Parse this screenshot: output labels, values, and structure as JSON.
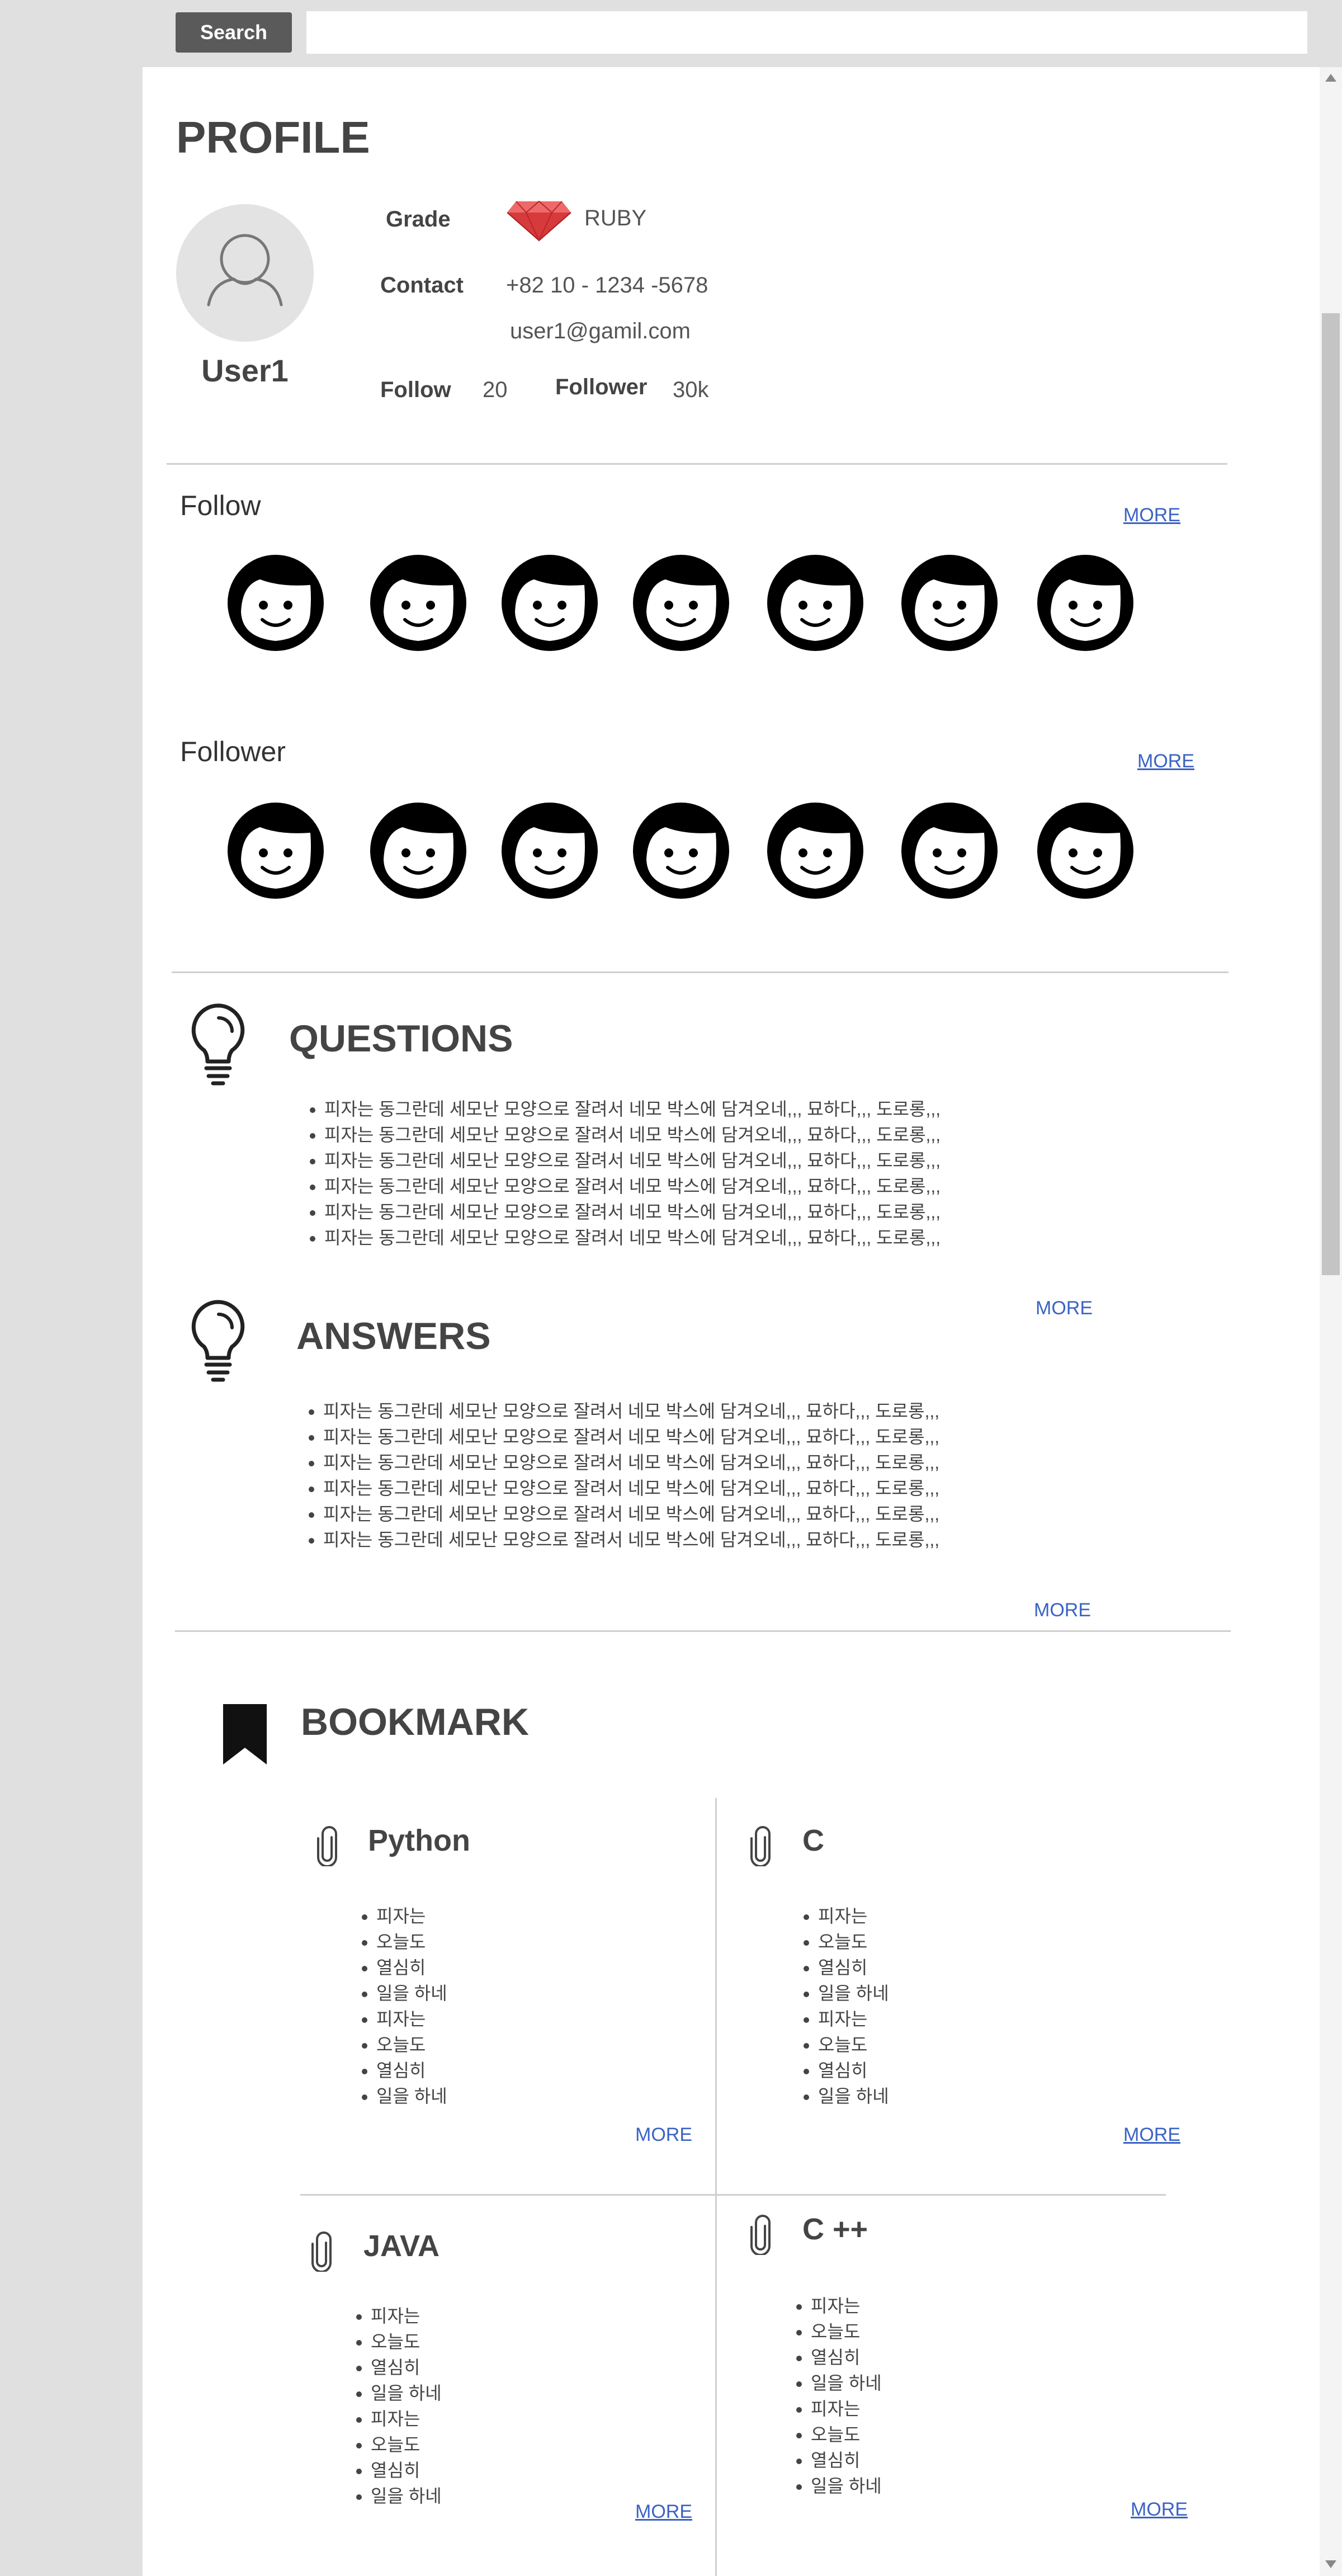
{
  "search": {
    "button_label": "Search",
    "placeholder": ""
  },
  "profile": {
    "heading": "PROFILE",
    "username": "User1",
    "grade_label": "Grade",
    "grade_value": "RUBY",
    "contact_label": "Contact",
    "phone": "+82 10 - 1234 -5678",
    "email": "user1@gamil.com",
    "follow_label": "Follow",
    "follow_count": "20",
    "follower_label": "Follower",
    "follower_count": "30k"
  },
  "follow_section": {
    "title": "Follow",
    "more": "MORE",
    "face_count": 7
  },
  "follower_section": {
    "title": "Follower",
    "more": "MORE",
    "face_count": 7
  },
  "questions": {
    "title": "QUESTIONS",
    "more": "MORE",
    "items": [
      "피자는 동그란데 세모난 모양으로 잘려서 네모 박스에 담겨오네,,, 묘하다,,, 도로롱,,,",
      "피자는 동그란데 세모난 모양으로 잘려서 네모 박스에 담겨오네,,, 묘하다,,, 도로롱,,,",
      "피자는 동그란데 세모난 모양으로 잘려서 네모 박스에 담겨오네,,, 묘하다,,, 도로롱,,,",
      "피자는 동그란데 세모난 모양으로 잘려서 네모 박스에 담겨오네,,, 묘하다,,, 도로롱,,,",
      "피자는 동그란데 세모난 모양으로 잘려서 네모 박스에 담겨오네,,, 묘하다,,, 도로롱,,,",
      "피자는 동그란데 세모난 모양으로 잘려서 네모 박스에 담겨오네,,, 묘하다,,, 도로롱,,,"
    ]
  },
  "answers": {
    "title": "ANSWERS",
    "more": "MORE",
    "items": [
      "피자는 동그란데 세모난 모양으로 잘려서 네모 박스에 담겨오네,,, 묘하다,,, 도로롱,,,",
      "피자는 동그란데 세모난 모양으로 잘려서 네모 박스에 담겨오네,,, 묘하다,,, 도로롱,,,",
      "피자는 동그란데 세모난 모양으로 잘려서 네모 박스에 담겨오네,,, 묘하다,,, 도로롱,,,",
      "피자는 동그란데 세모난 모양으로 잘려서 네모 박스에 담겨오네,,, 묘하다,,, 도로롱,,,",
      "피자는 동그란데 세모난 모양으로 잘려서 네모 박스에 담겨오네,,, 묘하다,,, 도로롱,,,",
      "피자는 동그란데 세모난 모양으로 잘려서 네모 박스에 담겨오네,,, 묘하다,,, 도로롱,,,"
    ]
  },
  "bookmark": {
    "title": "BOOKMARK",
    "categories": [
      {
        "name": "Python",
        "more": "MORE",
        "items": [
          "피자는",
          "오늘도",
          "열심히",
          "일을 하네",
          "피자는",
          "오늘도",
          "열심히",
          "일을 하네"
        ]
      },
      {
        "name": "C",
        "more": "MORE",
        "items": [
          "피자는",
          "오늘도",
          "열심히",
          "일을 하네",
          "피자는",
          "오늘도",
          "열심히",
          "일을 하네"
        ]
      },
      {
        "name": "JAVA",
        "more": "MORE",
        "items": [
          "피자는",
          "오늘도",
          "열심히",
          "일을 하네",
          "피자는",
          "오늘도",
          "열심히",
          "일을 하네"
        ]
      },
      {
        "name": "C ++",
        "more": "MORE",
        "items": [
          "피자는",
          "오늘도",
          "열심히",
          "일을 하네",
          "피자는",
          "오늘도",
          "열심히",
          "일을 하네"
        ]
      }
    ]
  },
  "colors": {
    "link": "#3b63c4",
    "ruby": "#d63a3a",
    "divider": "#cfcfcf",
    "search_button": "#5a5a5a"
  },
  "icons": [
    "user-placeholder-icon",
    "ruby-gem-icon",
    "face-icon",
    "lightbulb-icon",
    "bookmark-icon",
    "paperclip-icon"
  ]
}
